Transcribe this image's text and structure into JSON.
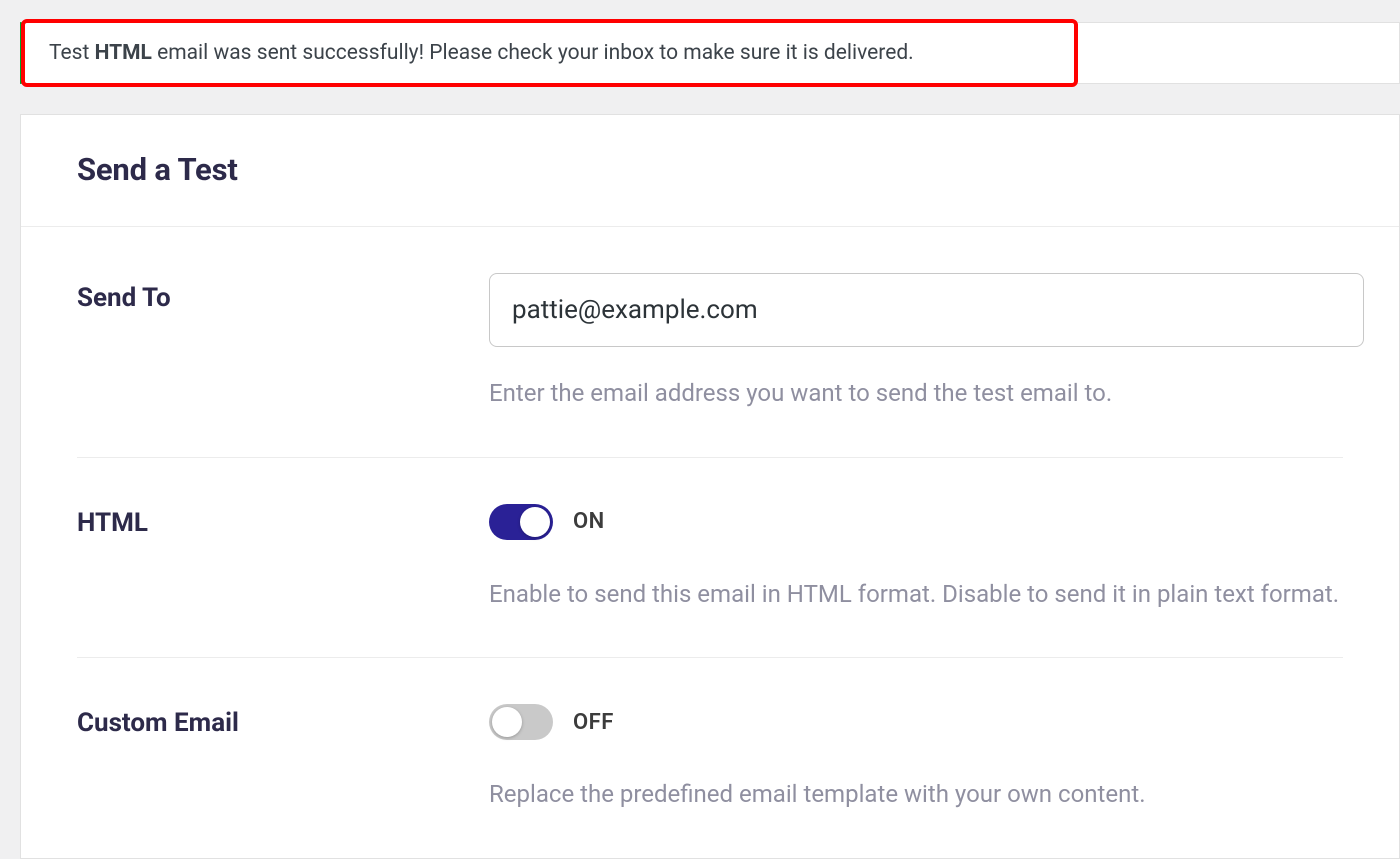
{
  "notice": {
    "prefix": "Test ",
    "bold": "HTML",
    "suffix": " email was sent successfully! Please check your inbox to make sure it is delivered."
  },
  "panel": {
    "title": "Send a Test"
  },
  "form": {
    "send_to": {
      "label": "Send To",
      "value": "pattie@example.com",
      "help": "Enter the email address you want to send the test email to."
    },
    "html": {
      "label": "HTML",
      "state": "ON",
      "help": "Enable to send this email in HTML format. Disable to send it in plain text format."
    },
    "custom_email": {
      "label": "Custom Email",
      "state": "OFF",
      "help": "Replace the predefined email template with your own content."
    }
  }
}
